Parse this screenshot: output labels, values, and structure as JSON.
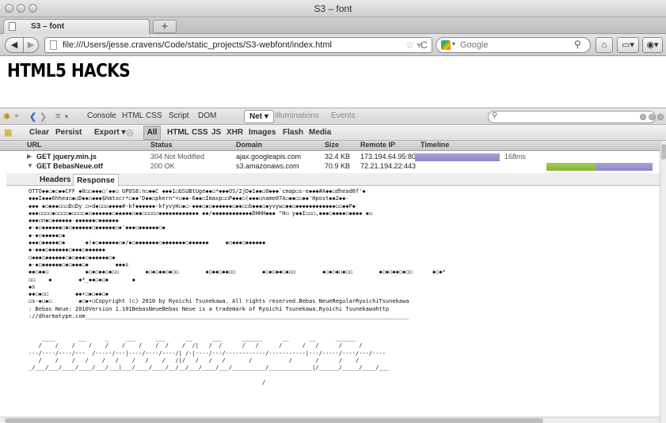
{
  "window": {
    "title": "S3 – font"
  },
  "tabs": [
    {
      "label": "S3 – font"
    }
  ],
  "nav": {
    "url": "file:///Users/jesse.cravens/Code/static_projects/S3-webfont/index.html",
    "search_placeholder": "Google"
  },
  "page": {
    "heading": "HTML5 HACKS"
  },
  "firebug": {
    "tabs": [
      "Console",
      "HTML",
      "CSS",
      "Script",
      "DOM",
      "Net ▾",
      "Illuminations",
      "Events"
    ],
    "filters": [
      "Clear",
      "Persist",
      "Export ▾",
      "All",
      "HTML",
      "CSS",
      "JS",
      "XHR",
      "Images",
      "Flash",
      "Media"
    ],
    "columns": [
      "URL",
      "Status",
      "Domain",
      "Size",
      "Remote IP",
      "Timeline"
    ],
    "requests": [
      {
        "url": "GET jquery.min.js",
        "status": "304 Not Modified",
        "domain": "ajax.googleapis.com",
        "size": "32.4 KB",
        "remote_ip": "173.194.64.95:80",
        "time": "168ms",
        "expanded": false
      },
      {
        "url": "GET BebasNeue.otf",
        "status": "200 OK",
        "domain": "s3.amazonaws.com",
        "size": "70.9 KB",
        "remote_ip": "72.21.194.22:443",
        "time": "",
        "expanded": true
      }
    ],
    "detail_tabs": [
      "Headers",
      "Response"
    ],
    "response_lines": [
      "OTTO◆◆◻◆◻◆◆CFF ◆0◻◻◆◆◆◻'◆◆◻ GPOS8:n◻◆◆C ◆◆◆1◻GSUBtUge◆◆◻*◆◆◆OS/2jD◆1◆◆◻0◆◆◆`cmap◻s-e◆◆◆#A◆◆◻dhead6f'◆",
      "◆◆◆I◆◆◆6hhea◻◆◻D◆◆◻◆◆◆$hmtxcr*◻◆◆'D◆◆◻pkern\"=◻◆◆-6◆◆◻Imaxp◻◻P◆◆◆◻(◆◆◆◻name07A◻◆◆◻◻◆◆'Hpost◆◆2◆◆-`",
      "◆◆◆ ◆◻◆◆◆◻◻◻D◻Dy ◻<d◆◻◻◻◆◆◆◆#-kf◆◆◆◆◆◆-kfyvyH◻◆◻-◆◆◆◻◆◻◆◆◆◆◆◆◻◆◆◻◻b◆◆◆◻◆yvyw◻◆◆◻◆◆◆◆◆◆◆◆◆◆◆◆◻◻◆◆P◆",
      "◆◆◆◻◻◻◻◆◻◻◻◻◆◻◻◻◻◆◻◆◆◆◆◆◆◻◆◆◆◆◆◻◆◆◻◻◻◻◻◆◆◆◆◆◆◆◆◆◆◆◆ ◆◆/◆◆◆◆◆◆◆◆◆◆◆◆DHHH◆◆◆ \"H◻ y◆◆I◻◻◻,◆◆◆◻◆◆◆◆◻◆◆◆◆ ◆◻",
      "◆◆◆◻n◆◻◆◆◆◆◆◆-◆◆◆◆◆◆◻◆◆◆◆◆◆",
      "◆-◆◻◆◆◆◆◆◆◻◆◻◆◆◆◆◆◆◻◆◆◆◆◆◆◻◆'◆◆◆◻◆◆◆◆◆◆◻◆",
      "◆-◆◻◆◆◆◆◆◻◆",
      "◆◆◆◻◆◆◆◆◆◻◆      ◆)◆◻◆◆◆◆◆◆◻◆/◆◻◆◆◆◆◆◆◆◻◆◆◆◆◆◆◆◻◆◆◆◆◆◆     ◆◻◆◆◆◻◆◆◆◆◆◆",
      "◆-◆◆◆◻◆◆◆◆◆◆◻◆◆◆◻◆◆◆◆◆◆",
      "◻◆◆◆◻◆◆◆◆◆◆◻◆◻◆◆◆◻◆◆◆◆◆◆◻◆",
      "◆-◆◻◆◆◆◆◆◆◻◆◻◆◆◆◻◆        ◆◆◆s",
      "◆◆◻◆◆◻           ◆◻◆◻◆◆◻◆◻◻        ◆◻◆◻◆◆◻◆◻◻        ◆◻◆◆◻◆◆◻◻        ◆◻◆◻◆◆◻◆◻◻        ◆◻◆◻◆◻◆◻◻        ◆◻◆◻◆◆◻◆◻◻      ◆◻◆*",
      "◻◻    ◆        ◆*_◆◆◻◆◻◆       ◆",
      "◆s",
      "◆◆◻◆◻◻        ◆◆•◻◆◻◆◆◻◆",
      "◻s-◆◻◆◻        ◆◻◆•◻Copyright (c) 2010 by Ryoichi Tsunekawa. All rights reserved.Bebas NeueRegularRyoichiTsunekawa",
      ": Bebas Neue: 2010Version 1.101BebasNeueBebas Neue is a trademark of Ryoichi Tsunekawa.Ryoichi Tsunekawahttp",
      "://dharmatype.com_________________________________________________________________________________________________",
      "",
      "",
      "    ____       __      _     ___      ___      __      ___      ______      __      __      ______",
      "   /    /    /    /    /    /    /    /  /    /  /|   /  /      /   /      /      /   /      /     /",
      "---/----/----/---  /-----/---|----/----/----/| /-|----/---/------------/-----------|---/-----/----/---/----",
      "   /    /    /   /    /   /    /   /    /   /|/   /   /   /       /           /       /      /    /",
      "_/___/___/____/____/___/___|___/____/____/__/__/___/____/___/__________/_____________|/______/_____/____/___",
      "",
      "                                                                      /"
    ]
  }
}
